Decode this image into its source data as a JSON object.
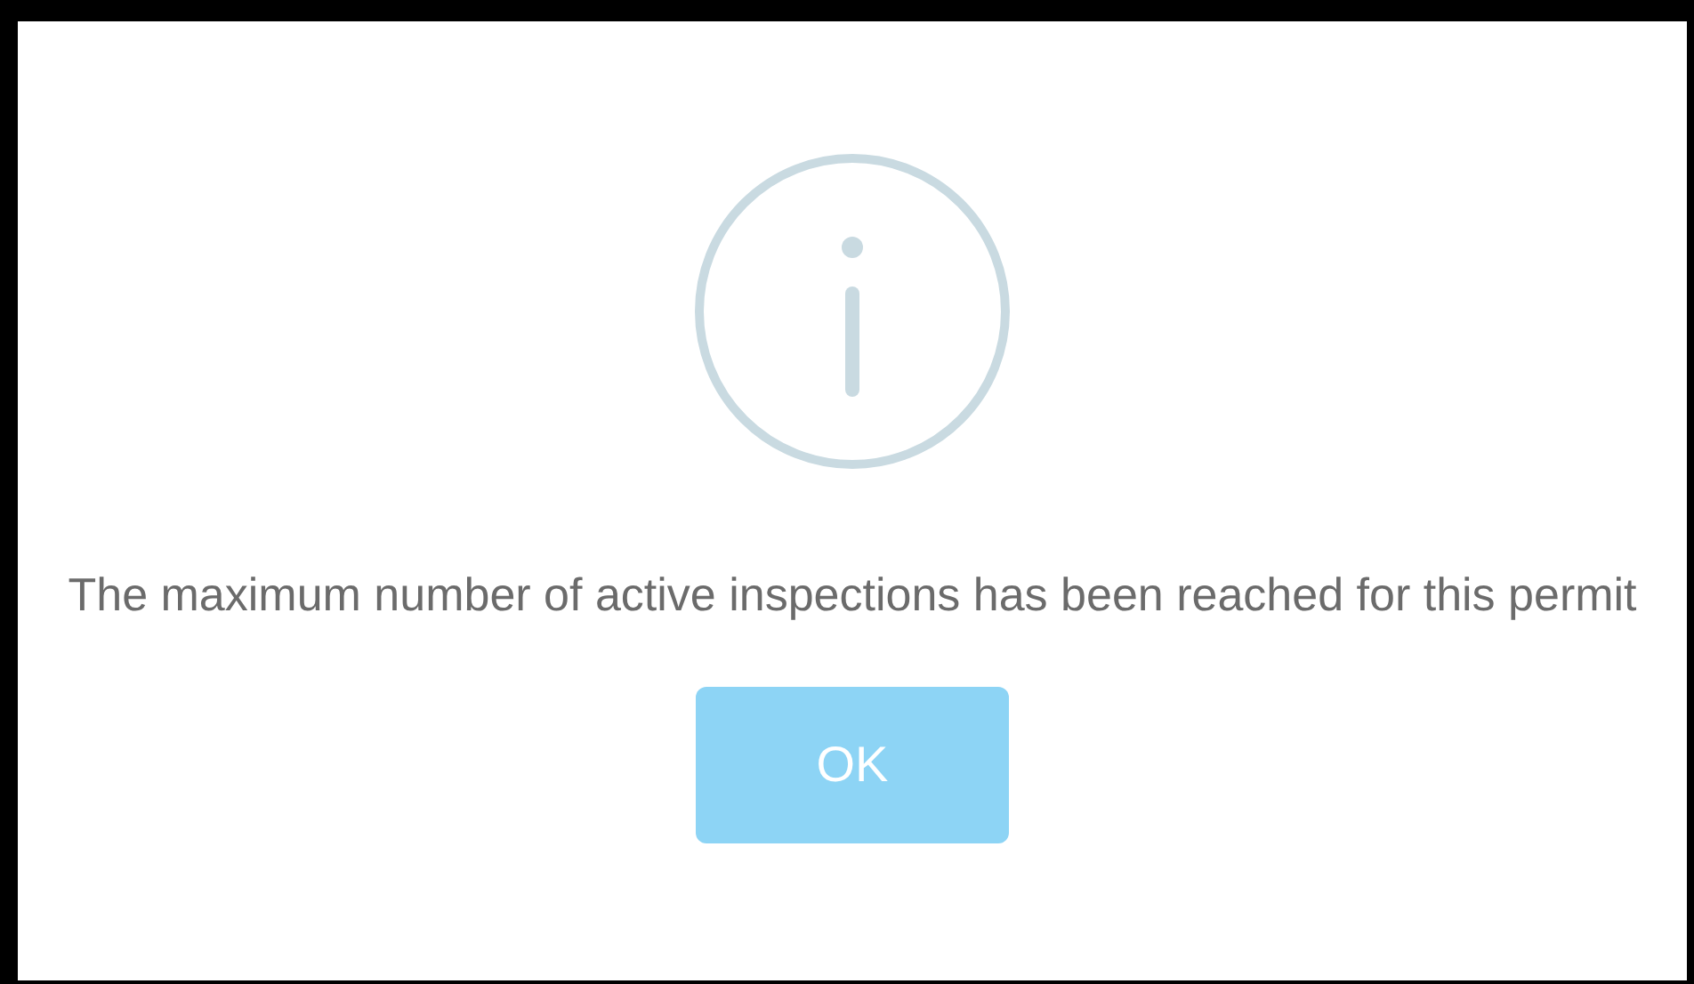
{
  "dialog": {
    "message": "The maximum number of active inspections has been reached for this permit",
    "buttons": [
      {
        "label": "OK",
        "kind": "primary"
      }
    ]
  }
}
